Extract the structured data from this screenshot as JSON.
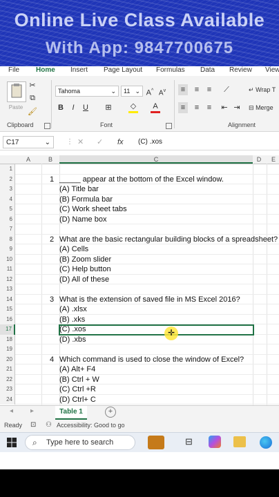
{
  "banner": {
    "line1": "Online Live Class Available",
    "line2": "With App: 9847700675"
  },
  "ribbon": {
    "tabs": [
      "File",
      "Home",
      "Insert",
      "Page Layout",
      "Formulas",
      "Data",
      "Review",
      "View"
    ],
    "paste_label": "Paste",
    "font_name": "Tahoma",
    "font_size": "11",
    "groups": {
      "clipboard": "Clipboard",
      "font": "Font",
      "alignment": "Alignment"
    },
    "wrap_text": "Wrap T",
    "merge": "Merge"
  },
  "formula_bar": {
    "name_box": "C17",
    "fx": "fx",
    "content": "(C) .xos"
  },
  "columns": [
    "A",
    "B",
    "C",
    "D",
    "E"
  ],
  "rows": [
    {
      "n": "1",
      "b": "",
      "c": ""
    },
    {
      "n": "2",
      "b": "1",
      "c": "_____ appear at the bottom of the Excel window."
    },
    {
      "n": "3",
      "b": "",
      "c": "(A) Title bar"
    },
    {
      "n": "4",
      "b": "",
      "c": "(B) Formula bar"
    },
    {
      "n": "5",
      "b": "",
      "c": "(C) Work sheet tabs"
    },
    {
      "n": "6",
      "b": "",
      "c": "(D) Name box"
    },
    {
      "n": "7",
      "b": "",
      "c": ""
    },
    {
      "n": "8",
      "b": "2",
      "c": "What are the basic rectangular building blocks of a spreadsheet?"
    },
    {
      "n": "9",
      "b": "",
      "c": "(A) Cells"
    },
    {
      "n": "10",
      "b": "",
      "c": "(B) Zoom slider"
    },
    {
      "n": "11",
      "b": "",
      "c": "(C) Help button"
    },
    {
      "n": "12",
      "b": "",
      "c": "(D) All of these"
    },
    {
      "n": "13",
      "b": "",
      "c": ""
    },
    {
      "n": "14",
      "b": "3",
      "c": "What is the extension of saved file in MS Excel 2016?"
    },
    {
      "n": "15",
      "b": "",
      "c": "(A) .xlsx"
    },
    {
      "n": "16",
      "b": "",
      "c": "(B) .xks"
    },
    {
      "n": "17",
      "b": "",
      "c": "(C) .xos"
    },
    {
      "n": "18",
      "b": "",
      "c": "(D) .xbs"
    },
    {
      "n": "19",
      "b": "",
      "c": ""
    },
    {
      "n": "20",
      "b": "4",
      "c": "Which command is used to close the window of Excel?"
    },
    {
      "n": "21",
      "b": "",
      "c": "(A) Alt+ F4"
    },
    {
      "n": "22",
      "b": "",
      "c": "(B) Ctrl + W"
    },
    {
      "n": "23",
      "b": "",
      "c": "(C) Ctrl +R"
    },
    {
      "n": "24",
      "b": "",
      "c": "(D) Ctrl+ C"
    }
  ],
  "sheet_tab": "Table 1",
  "status": {
    "ready": "Ready",
    "accessibility": "Accessibility: Good to go"
  },
  "taskbar": {
    "search_placeholder": "Type here to search"
  },
  "colors": {
    "excel_green": "#217346",
    "banner_blue": "#1f35b8"
  }
}
